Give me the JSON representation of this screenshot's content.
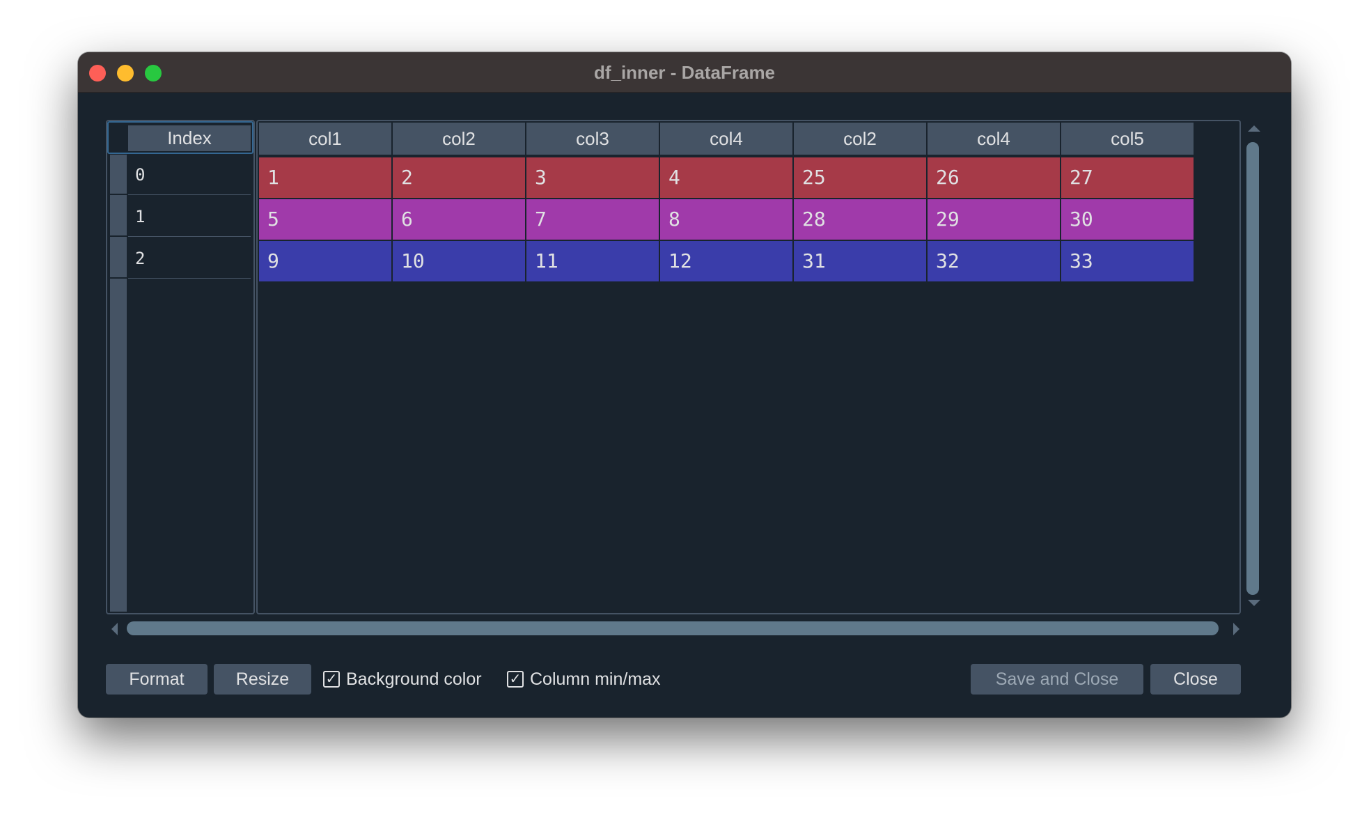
{
  "window": {
    "title": "df_inner - DataFrame"
  },
  "index": {
    "header": "Index",
    "rows": [
      "0",
      "1",
      "2"
    ]
  },
  "table": {
    "columns": [
      "col1",
      "col2",
      "col3",
      "col4",
      "col2",
      "col4",
      "col5"
    ],
    "rows": [
      [
        "1",
        "2",
        "3",
        "4",
        "25",
        "26",
        "27"
      ],
      [
        "5",
        "6",
        "7",
        "8",
        "28",
        "29",
        "30"
      ],
      [
        "9",
        "10",
        "11",
        "12",
        "31",
        "32",
        "33"
      ]
    ],
    "row_colors": [
      "#a63a48",
      "#a03aaa",
      "#3a3daa"
    ]
  },
  "toolbar": {
    "format_label": "Format",
    "resize_label": "Resize",
    "background_color_label": "Background color",
    "background_color_checked": true,
    "column_minmax_label": "Column min/max",
    "column_minmax_checked": true,
    "save_close_label": "Save and Close",
    "close_label": "Close"
  },
  "colors": {
    "background": "#19232d",
    "header": "#455364",
    "accent": "#346792",
    "text": "#e0e1e3"
  }
}
